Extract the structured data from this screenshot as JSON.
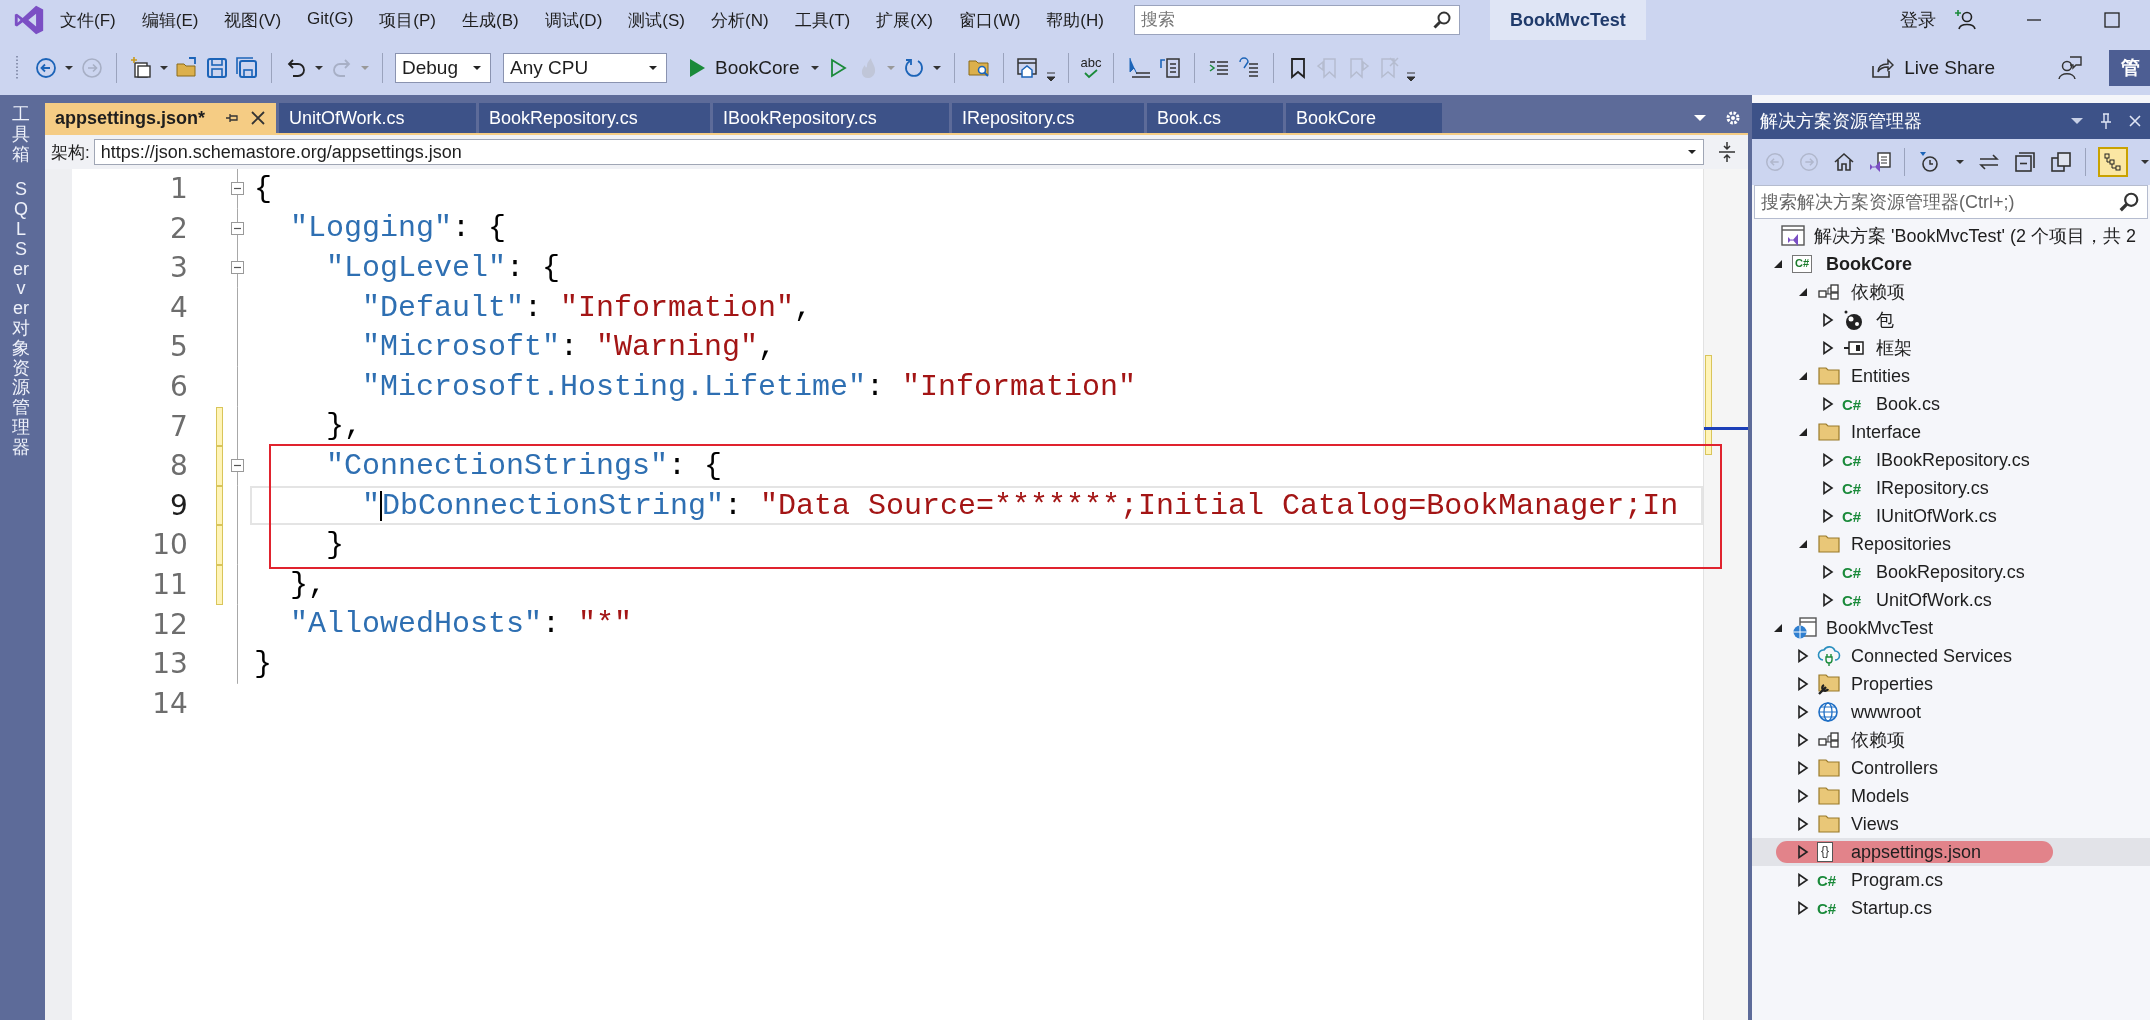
{
  "title_bar": {
    "menu": [
      "文件(F)",
      "编辑(E)",
      "视图(V)",
      "Git(G)",
      "项目(P)",
      "生成(B)",
      "调试(D)",
      "测试(S)",
      "分析(N)",
      "工具(T)",
      "扩展(X)",
      "窗口(W)",
      "帮助(H)"
    ],
    "search": {
      "placeholder": "搜索"
    },
    "solution_name": "BookMvcTest",
    "sign_in": "登录"
  },
  "toolbar": {
    "configuration": "Debug",
    "platform": "Any CPU",
    "start_target": "BookCore",
    "spell_label": "abc",
    "live_share": "Live Share",
    "admin_button": "管"
  },
  "side_strip": [
    "工具箱",
    "SQL Server 对象资源管理器"
  ],
  "tabs": [
    {
      "label": "appsettings.json*",
      "selected": true
    },
    {
      "label": "UnitOfWork.cs",
      "selected": false
    },
    {
      "label": "BookRepository.cs",
      "selected": false
    },
    {
      "label": "IBookRepository.cs",
      "selected": false
    },
    {
      "label": "IRepository.cs",
      "selected": false
    },
    {
      "label": "Book.cs",
      "selected": false
    },
    {
      "label": "BookCore",
      "selected": false
    }
  ],
  "schema": {
    "label": "架构:",
    "value": "https://json.schemastore.org/appsettings.json"
  },
  "editor": {
    "lines": [
      {
        "number": "1",
        "fold": true,
        "modified": false,
        "current": false,
        "tokens": [
          {
            "kind": "punct",
            "text": "{"
          }
        ]
      },
      {
        "number": "2",
        "fold": true,
        "modified": false,
        "current": false,
        "tokens": [
          {
            "kind": "key",
            "text": "  \"Logging\""
          },
          {
            "kind": "punct",
            "text": ": {"
          }
        ]
      },
      {
        "number": "3",
        "fold": true,
        "modified": false,
        "current": false,
        "tokens": [
          {
            "kind": "key",
            "text": "    \"LogLevel\""
          },
          {
            "kind": "punct",
            "text": ": {"
          }
        ]
      },
      {
        "number": "4",
        "fold": false,
        "modified": false,
        "current": false,
        "tokens": [
          {
            "kind": "key",
            "text": "      \"Default\""
          },
          {
            "kind": "punct",
            "text": ": "
          },
          {
            "kind": "string",
            "text": "\"Information\""
          },
          {
            "kind": "punct",
            "text": ","
          }
        ]
      },
      {
        "number": "5",
        "fold": false,
        "modified": false,
        "current": false,
        "tokens": [
          {
            "kind": "key",
            "text": "      \"Microsoft\""
          },
          {
            "kind": "punct",
            "text": ": "
          },
          {
            "kind": "string",
            "text": "\"Warning\""
          },
          {
            "kind": "punct",
            "text": ","
          }
        ]
      },
      {
        "number": "6",
        "fold": false,
        "modified": false,
        "current": false,
        "tokens": [
          {
            "kind": "key",
            "text": "      \"Microsoft.Hosting.Lifetime\""
          },
          {
            "kind": "punct",
            "text": ": "
          },
          {
            "kind": "string",
            "text": "\"Information\""
          }
        ]
      },
      {
        "number": "7",
        "fold": false,
        "modified": true,
        "current": false,
        "tokens": [
          {
            "kind": "punct",
            "text": "    },"
          }
        ]
      },
      {
        "number": "8",
        "fold": true,
        "modified": true,
        "current": false,
        "tokens": [
          {
            "kind": "key",
            "text": "    \"ConnectionStrings\""
          },
          {
            "kind": "punct",
            "text": ": {"
          }
        ]
      },
      {
        "number": "9",
        "fold": false,
        "modified": true,
        "current": true,
        "tokens": [
          {
            "kind": "key",
            "text": "      \""
          },
          {
            "kind": "caret"
          },
          {
            "kind": "key",
            "text": "DbConnectionString\""
          },
          {
            "kind": "punct",
            "text": ": "
          },
          {
            "kind": "string",
            "text": "\"Data Source=*******;Initial Catalog=BookManager;In"
          }
        ]
      },
      {
        "number": "10",
        "fold": false,
        "modified": true,
        "current": false,
        "tokens": [
          {
            "kind": "punct",
            "text": "    }"
          }
        ]
      },
      {
        "number": "11",
        "fold": false,
        "modified": true,
        "current": false,
        "tokens": [
          {
            "kind": "punct",
            "text": "  },"
          }
        ]
      },
      {
        "number": "12",
        "fold": false,
        "modified": false,
        "current": false,
        "tokens": [
          {
            "kind": "key",
            "text": "  \"AllowedHosts\""
          },
          {
            "kind": "punct",
            "text": ": "
          },
          {
            "kind": "string",
            "text": "\"*\""
          }
        ]
      },
      {
        "number": "13",
        "fold": false,
        "modified": false,
        "current": false,
        "tokens": [
          {
            "kind": "punct",
            "text": "}"
          }
        ]
      },
      {
        "number": "14",
        "fold": false,
        "modified": false,
        "current": false
      }
    ]
  },
  "solution_explorer": {
    "title": "解决方案资源管理器",
    "search": {
      "placeholder": "搜索解决方案资源管理器(Ctrl+;)"
    },
    "tree": [
      {
        "label": "解决方案 'BookMvcTest' (2 个项目，共 2",
        "kind": "solution",
        "selected": false,
        "annotated": false,
        "bold": false,
        "children": [
          {
            "label": "BookCore",
            "kind": "project",
            "badge": "C#",
            "expanded": true,
            "selected": false,
            "annotated": false,
            "bold": true,
            "children": [
              {
                "label": "依赖项",
                "kind": "deps",
                "expanded": true,
                "selected": false,
                "annotated": false,
                "bold": false,
                "children": [
                  {
                    "label": "包",
                    "kind": "package",
                    "expanded": false,
                    "selected": false,
                    "annotated": false,
                    "bold": false
                  },
                  {
                    "label": "框架",
                    "kind": "framework",
                    "expanded": false,
                    "selected": false,
                    "annotated": false,
                    "bold": false
                  }
                ]
              },
              {
                "label": "Entities",
                "kind": "folder",
                "expanded": true,
                "selected": false,
                "annotated": false,
                "bold": false,
                "children": [
                  {
                    "label": "Book.cs",
                    "kind": "cs",
                    "badge": "C#",
                    "expanded": false,
                    "selected": false,
                    "annotated": false,
                    "bold": false
                  }
                ]
              },
              {
                "label": "Interface",
                "kind": "folder",
                "expanded": true,
                "selected": false,
                "annotated": false,
                "bold": false,
                "children": [
                  {
                    "label": "IBookRepository.cs",
                    "kind": "cs",
                    "badge": "C#",
                    "expanded": false,
                    "selected": false,
                    "annotated": false,
                    "bold": false
                  },
                  {
                    "label": "IRepository.cs",
                    "kind": "cs",
                    "badge": "C#",
                    "expanded": false,
                    "selected": false,
                    "annotated": false,
                    "bold": false
                  },
                  {
                    "label": "IUnitOfWork.cs",
                    "kind": "cs",
                    "badge": "C#",
                    "expanded": false,
                    "selected": false,
                    "annotated": false,
                    "bold": false
                  }
                ]
              },
              {
                "label": "Repositories",
                "kind": "folder",
                "expanded": true,
                "selected": false,
                "annotated": false,
                "bold": false,
                "children": [
                  {
                    "label": "BookRepository.cs",
                    "kind": "cs",
                    "badge": "C#",
                    "expanded": false,
                    "selected": false,
                    "annotated": false,
                    "bold": false
                  },
                  {
                    "label": "UnitOfWork.cs",
                    "kind": "cs",
                    "badge": "C#",
                    "expanded": false,
                    "selected": false,
                    "annotated": false,
                    "bold": false
                  }
                ]
              }
            ]
          },
          {
            "label": "BookMvcTest",
            "kind": "webproject",
            "expanded": true,
            "selected": false,
            "annotated": false,
            "bold": false,
            "children": [
              {
                "label": "Connected Services",
                "kind": "cloud",
                "expanded": false,
                "selected": false,
                "annotated": false,
                "bold": false
              },
              {
                "label": "Properties",
                "kind": "properties",
                "expanded": false,
                "selected": false,
                "annotated": false,
                "bold": false
              },
              {
                "label": "wwwroot",
                "kind": "globe",
                "expanded": false,
                "selected": false,
                "annotated": false,
                "bold": false
              },
              {
                "label": "依赖项",
                "kind": "deps",
                "expanded": false,
                "selected": false,
                "annotated": false,
                "bold": false
              },
              {
                "label": "Controllers",
                "kind": "folder",
                "expanded": false,
                "selected": false,
                "annotated": false,
                "bold": false
              },
              {
                "label": "Models",
                "kind": "folder",
                "expanded": false,
                "selected": false,
                "annotated": false,
                "bold": false
              },
              {
                "label": "Views",
                "kind": "folder",
                "expanded": false,
                "selected": false,
                "annotated": false,
                "bold": false
              },
              {
                "label": "appsettings.json",
                "kind": "json",
                "badge": "{}",
                "expanded": false,
                "selected": true,
                "annotated": true,
                "bold": false
              },
              {
                "label": "Program.cs",
                "kind": "cs",
                "badge": "C#",
                "expanded": false,
                "selected": false,
                "annotated": false,
                "bold": false
              },
              {
                "label": "Startup.cs",
                "kind": "cs",
                "badge": "C#",
                "expanded": false,
                "selected": false,
                "annotated": false,
                "bold": false
              }
            ]
          }
        ]
      }
    ]
  }
}
